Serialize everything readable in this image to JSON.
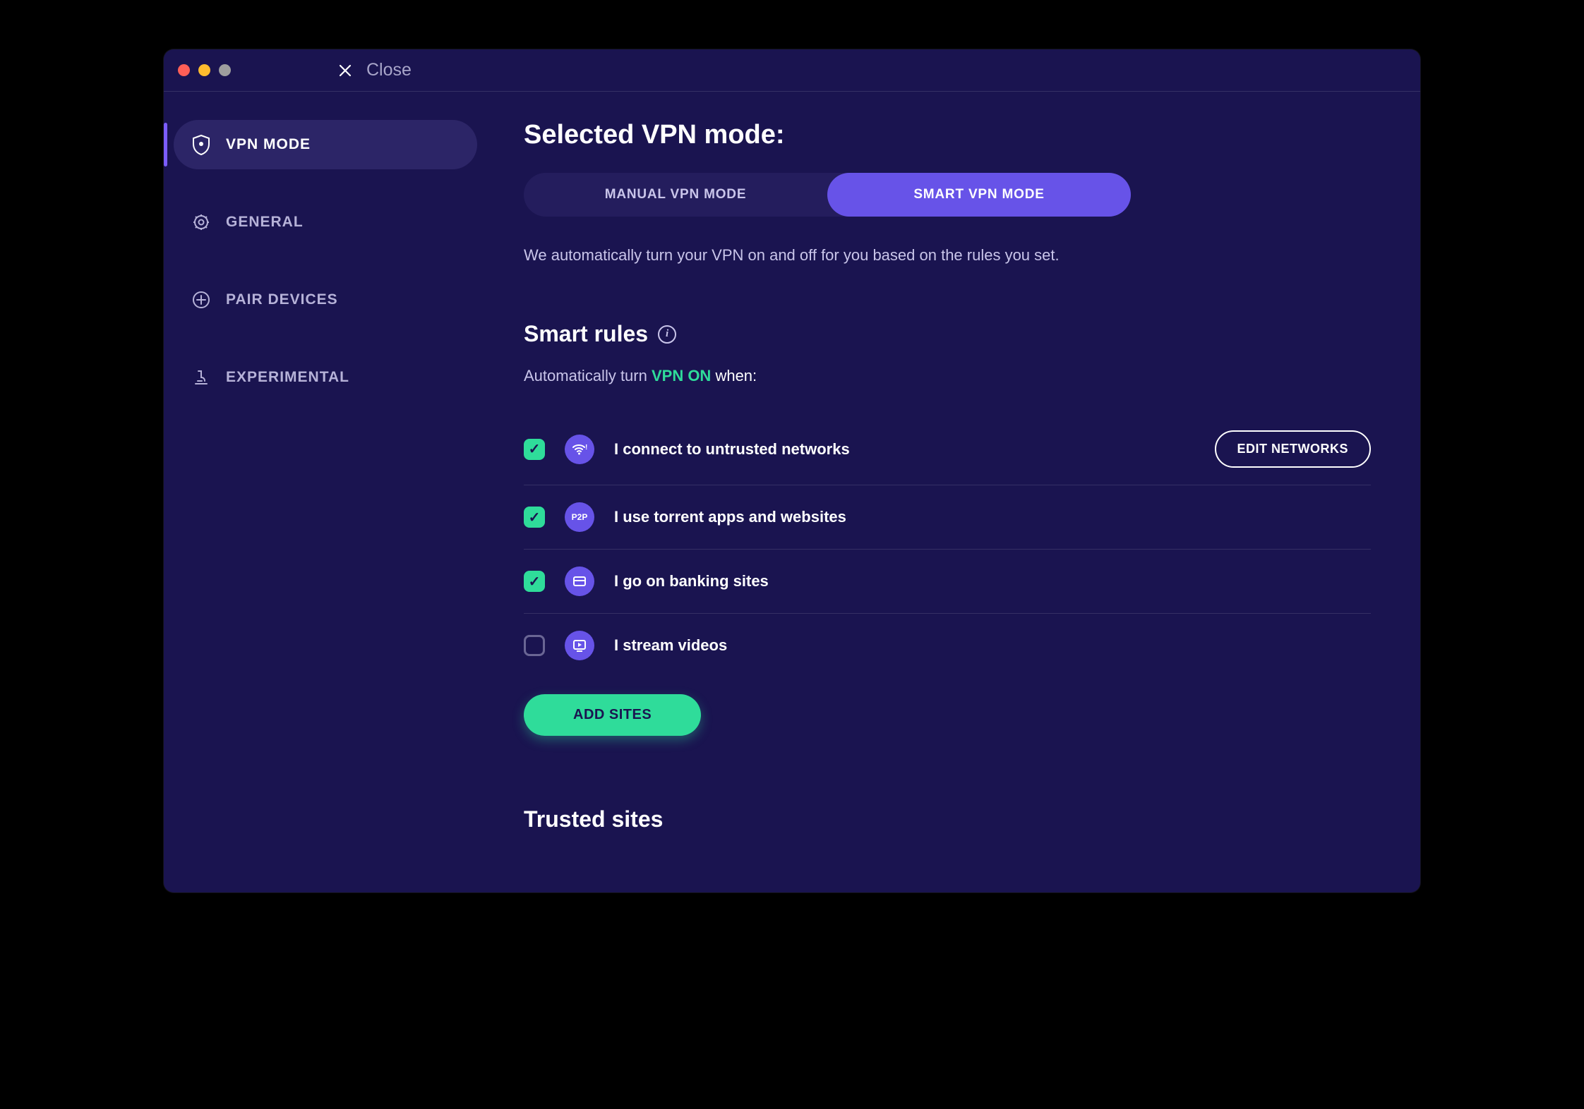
{
  "titlebar": {
    "close_label": "Close"
  },
  "sidebar": {
    "items": [
      {
        "label": "VPN MODE",
        "icon": "shield-gear-icon",
        "active": true
      },
      {
        "label": "GENERAL",
        "icon": "gear-icon",
        "active": false
      },
      {
        "label": "PAIR DEVICES",
        "icon": "plus-circle-icon",
        "active": false
      },
      {
        "label": "EXPERIMENTAL",
        "icon": "microscope-icon",
        "active": false
      }
    ]
  },
  "main": {
    "heading": "Selected VPN mode:",
    "modes": {
      "manual": "MANUAL VPN MODE",
      "smart": "SMART VPN MODE"
    },
    "description": "We automatically turn your VPN on and off for you based on the rules you set.",
    "smart_rules_title": "Smart rules",
    "smart_rules_sub_prefix": "Automatically turn ",
    "smart_rules_sub_highlight": "VPN ON",
    "smart_rules_sub_suffix": " when:",
    "rules": [
      {
        "checked": true,
        "icon": "wifi-alert-icon",
        "label": "I connect to untrusted networks",
        "action": "EDIT NETWORKS"
      },
      {
        "checked": true,
        "icon": "p2p-icon",
        "label": "I use torrent apps and websites"
      },
      {
        "checked": true,
        "icon": "banking-icon",
        "label": "I go on banking sites"
      },
      {
        "checked": false,
        "icon": "stream-icon",
        "label": "I stream videos"
      }
    ],
    "add_sites_label": "ADD SITES",
    "trusted_sites_title": "Trusted sites"
  }
}
